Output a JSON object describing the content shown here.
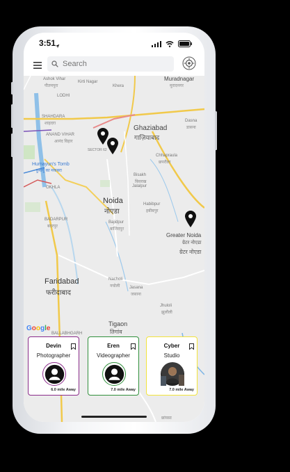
{
  "status": {
    "time": "3:51"
  },
  "search": {
    "placeholder": "Search"
  },
  "map": {
    "labels": {
      "ashok_vihar": "Ashok Vihar",
      "pitampura": "पीतमपुरा",
      "kirti_nagar": "Kirti Nagar",
      "lodhi": "LODHI",
      "shahdara": "SHAHDARA",
      "shahdara_hi": "शाहदरा",
      "anand_vihar": "ANAND VIHAR",
      "anand_vihar_hi": "आनंद विहार",
      "humayun": "Humayun's Tomb",
      "humayun_hi": "हुमायूँ का मकबरा",
      "okhla": "OKHLA",
      "badarpur": "BADARPUR",
      "badarpur_hi": "बदरपुर",
      "sector": "SECTOR 62",
      "khera": "Khera",
      "muradnagar": "Muradnagar",
      "muradnagar_hi": "मुरादनगर",
      "ghaziabad": "Ghaziabad",
      "ghaziabad_hi": "गाज़ियाबाद",
      "dasna": "Dasna",
      "dasna_hi": "डासना",
      "chhapraula": "Chhapraula",
      "chhapraula_hi": "छपरौला",
      "bisakh": "Bisakh",
      "bisakh_hi": "बिसरख",
      "jalalpur": "Jalalpur",
      "noida": "Noida",
      "noida_hi": "नोएडा",
      "habibpur": "Habibpur",
      "habibpur_hi": "हबीबपुर",
      "bajidpur": "Bajidpur",
      "bajidpur_hi": "बाजिदपुर",
      "greater_noida": "Greater Noida",
      "greater_noida_hi": "ग्रेटर नोएडा",
      "faridabad": "Faridabad",
      "faridabad_hi": "फरीदाबाद",
      "nacholi": "Nacholi",
      "nacholi_hi": "नचोली",
      "jasana": "Jasana",
      "jasana_hi": "जसाना",
      "jhuloli": "Jhuloli",
      "jhuloli_hi": "झुलौली",
      "tigaon": "Tigaon",
      "tigaon_hi": "तिगांव",
      "ballabhgarh": "BALLABHGARH",
      "chhainsa_hi": "छांयसा",
      "google": "Google"
    }
  },
  "cards": [
    {
      "name": "Devin",
      "role": "Photographer",
      "distance": "6.0 mile Away",
      "border": "#8a2a8a"
    },
    {
      "name": "Eren",
      "role": "Videographer",
      "distance": "7.0 mile Away",
      "border": "#2f8f3a"
    },
    {
      "name": "Cyber",
      "role": "Studio",
      "distance": "7.0 mile Away",
      "border": "#f2e33a"
    }
  ],
  "colors": {
    "accent_purple": "#8a2a8a",
    "accent_green": "#2f8f3a",
    "accent_yellow": "#f2e33a"
  },
  "icons": [
    "menu-icon",
    "search-icon",
    "locate-icon",
    "map-pin-icon",
    "bookmark-icon",
    "user-avatar-icon",
    "wifi-icon",
    "battery-icon",
    "signal-icon"
  ]
}
